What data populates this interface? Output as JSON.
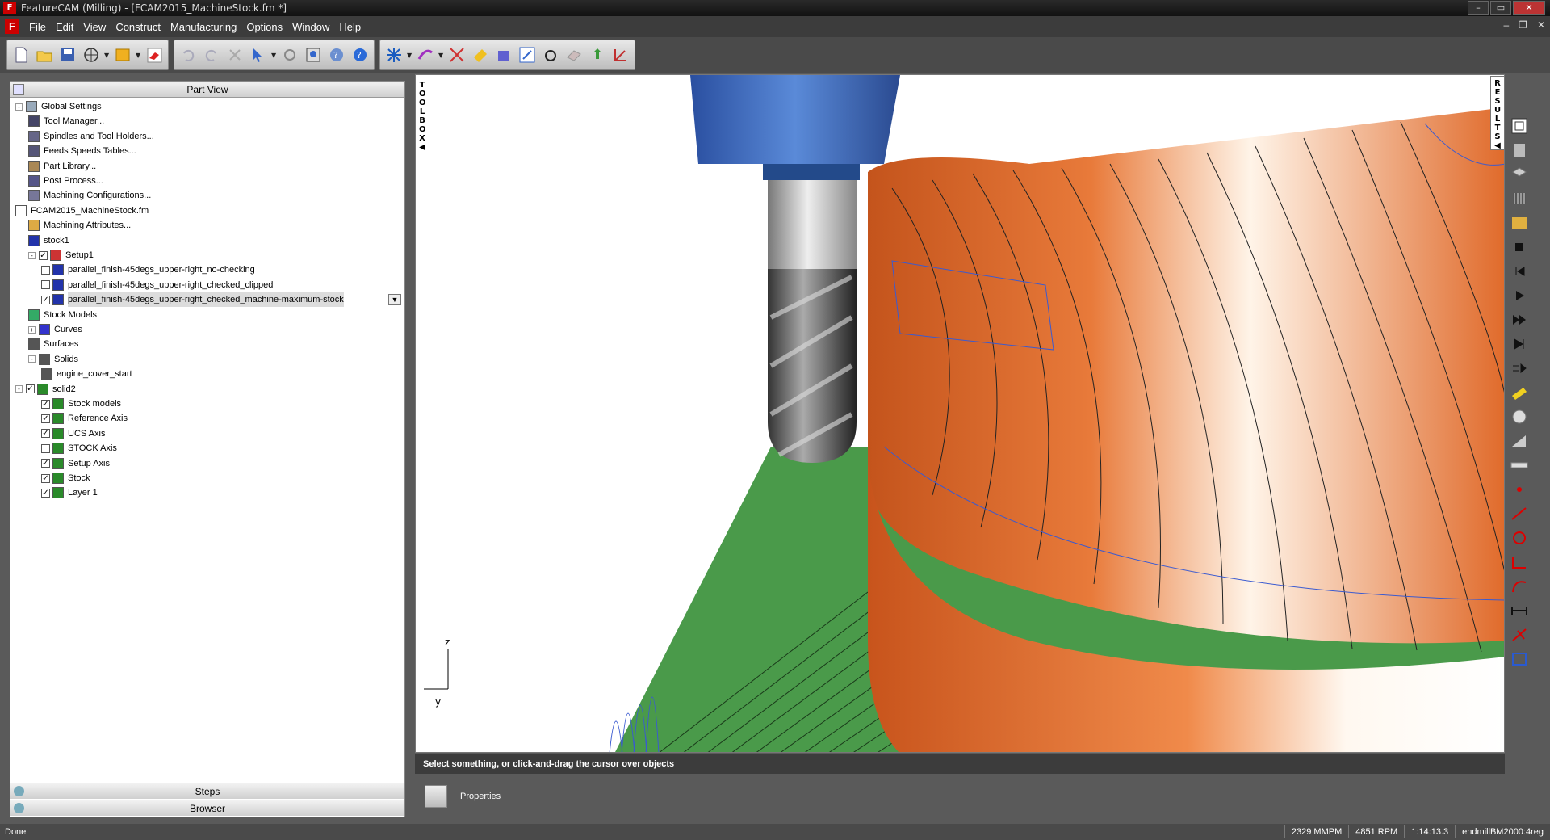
{
  "window": {
    "title": "FeatureCAM (Milling) - [FCAM2015_MachineStock.fm *]"
  },
  "menu": [
    "File",
    "Edit",
    "View",
    "Construct",
    "Manufacturing",
    "Options",
    "Window",
    "Help"
  ],
  "toolbox_label": "TOOLBOX",
  "results_label": "RESULTS",
  "part_view": {
    "title": "Part View",
    "tree": [
      {
        "label": "Global Settings",
        "level": 0,
        "expand": "-",
        "icon": "globe-icon",
        "check": null
      },
      {
        "label": "Tool Manager...",
        "level": 1,
        "expand": null,
        "icon": "tool-manager-icon",
        "check": null
      },
      {
        "label": "Spindles and Tool Holders...",
        "level": 1,
        "expand": null,
        "icon": "spindle-icon",
        "check": null
      },
      {
        "label": "Feeds  Speeds Tables...",
        "level": 1,
        "expand": null,
        "icon": "feeds-icon",
        "check": null
      },
      {
        "label": "Part Library...",
        "level": 1,
        "expand": null,
        "icon": "library-icon",
        "check": null
      },
      {
        "label": "Post Process...",
        "level": 1,
        "expand": null,
        "icon": "post-process-icon",
        "check": null
      },
      {
        "label": "Machining Configurations...",
        "level": 1,
        "expand": null,
        "icon": "machining-config-icon",
        "check": null
      },
      {
        "label": "FCAM2015_MachineStock.fm",
        "level": 0,
        "expand": null,
        "icon": "document-icon",
        "check": null
      },
      {
        "label": "Machining Attributes...",
        "level": 1,
        "expand": null,
        "icon": "attributes-icon",
        "check": null
      },
      {
        "label": "stock1",
        "level": 1,
        "expand": null,
        "icon": "stock-icon",
        "check": null
      },
      {
        "label": "Setup1",
        "level": 1,
        "expand": "-",
        "icon": "setup-icon",
        "check": true
      },
      {
        "label": "parallel_finish-45degs_upper-right_no-checking",
        "level": 2,
        "expand": null,
        "icon": "operation-icon",
        "check": false
      },
      {
        "label": "parallel_finish-45degs_upper-right_checked_clipped",
        "level": 2,
        "expand": null,
        "icon": "operation-icon",
        "check": false
      },
      {
        "label": "parallel_finish-45degs_upper-right_checked_machine-maximum-stock",
        "level": 2,
        "expand": null,
        "icon": "operation-icon",
        "check": true,
        "selected": true
      },
      {
        "label": "Stock Models",
        "level": 1,
        "expand": null,
        "icon": "stock-models-icon",
        "check": null
      },
      {
        "label": "Curves",
        "level": 1,
        "expand": "+",
        "icon": "curve-icon",
        "check": null
      },
      {
        "label": "Surfaces",
        "level": 1,
        "expand": null,
        "icon": "surface-icon",
        "check": null
      },
      {
        "label": "Solids",
        "level": 1,
        "expand": "-",
        "icon": "solid-icon",
        "check": null
      },
      {
        "label": "engine_cover_start",
        "level": 2,
        "expand": null,
        "icon": "solid-icon",
        "check": null
      },
      {
        "label": "solid2",
        "level": 0,
        "expand": "-",
        "icon": "layer-icon",
        "check": true
      },
      {
        "label": "Stock models",
        "level": 2,
        "expand": null,
        "icon": "layer-icon",
        "check": true
      },
      {
        "label": "Reference Axis",
        "level": 2,
        "expand": null,
        "icon": "layer-icon",
        "check": true
      },
      {
        "label": "UCS Axis",
        "level": 2,
        "expand": null,
        "icon": "layer-icon",
        "check": true
      },
      {
        "label": "STOCK Axis",
        "level": 2,
        "expand": null,
        "icon": "layer-icon",
        "check": false
      },
      {
        "label": "Setup Axis",
        "level": 2,
        "expand": null,
        "icon": "layer-icon",
        "check": true
      },
      {
        "label": "Stock",
        "level": 2,
        "expand": null,
        "icon": "layer-icon",
        "check": true
      },
      {
        "label": "Layer 1",
        "level": 2,
        "expand": null,
        "icon": "layer-icon",
        "check": true
      }
    ],
    "steps_label": "Steps",
    "browser_label": "Browser"
  },
  "axis_labels": {
    "z": "z",
    "y": "y"
  },
  "status_message": "Select something, or click-and-drag the cursor over objects",
  "properties_label": "Properties",
  "statusbar": {
    "left": "Done",
    "feed": "2329 MMPM",
    "speed": "4851 RPM",
    "time": "1:14:13.3",
    "tool": "endmillBM2000:4reg"
  },
  "colors": {
    "stock_orange": "#e06a2a",
    "floor_green": "#4a9a4a",
    "holder_blue": "#2a5fb0"
  }
}
